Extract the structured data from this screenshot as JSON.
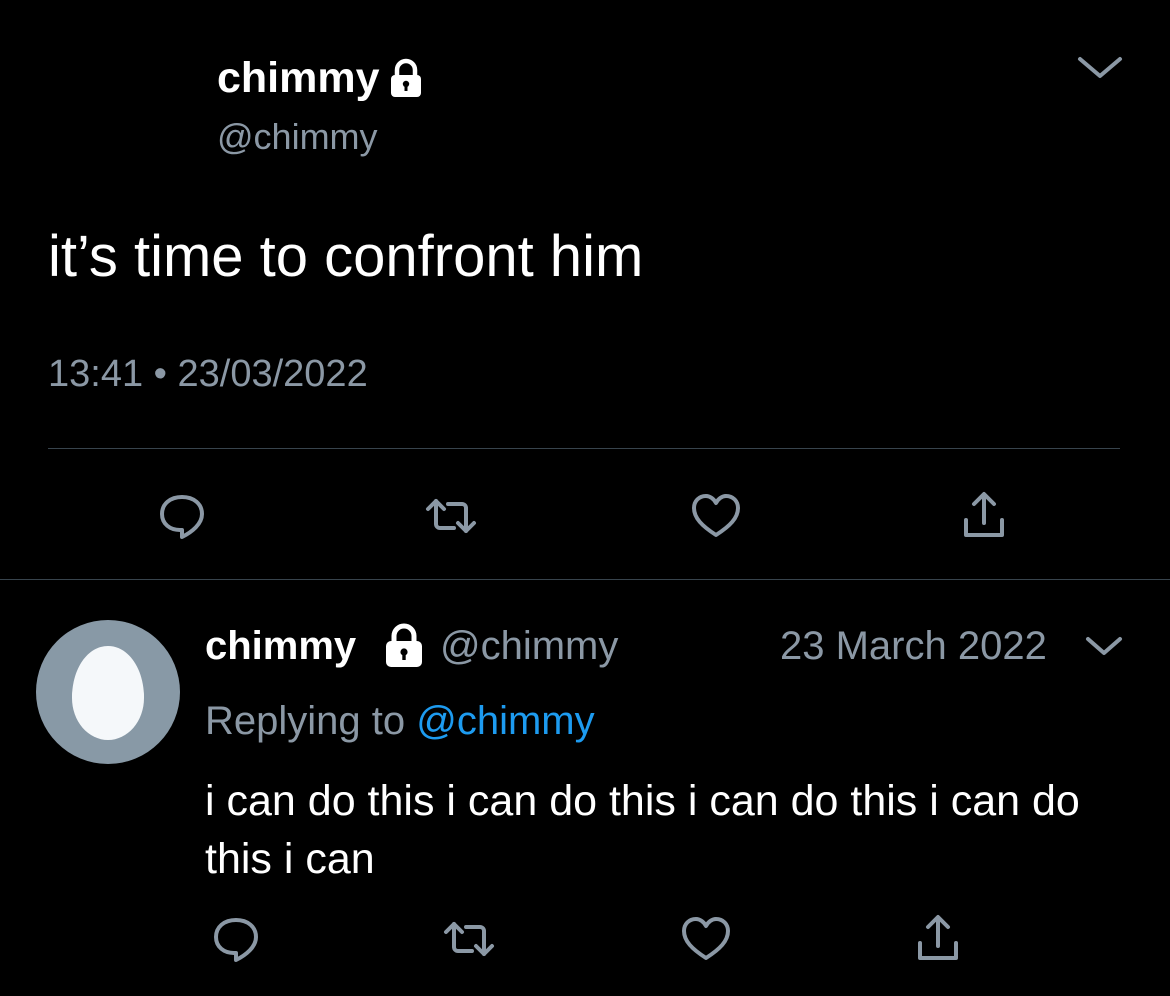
{
  "main_tweet": {
    "display_name": "chimmy",
    "handle": "@chimmy",
    "text": "it’s time to confront him",
    "timestamp": "13:41 • 23/03/2022",
    "icons": {
      "protected": "lock-icon",
      "more": "chevron-down-icon",
      "reply": "reply-icon",
      "retweet": "retweet-icon",
      "like": "heart-icon",
      "share": "share-icon"
    }
  },
  "reply_tweet": {
    "display_name": "chimmy",
    "handle": "@chimmy",
    "date": "23 March 2022",
    "replying_prefix": "Replying to ",
    "replying_to": "@chimmy",
    "text": "i can do this i can do this i can do this i can do this i can",
    "avatar": "default-egg-avatar"
  },
  "colors": {
    "background": "#000000",
    "text_primary": "#ffffff",
    "text_secondary": "#8b98a5",
    "link": "#1d9bf0",
    "divider": "#38444d",
    "icon": "#8b98a5",
    "avatar_bg": "#8899a6",
    "avatar_egg": "#f5f8fa"
  }
}
